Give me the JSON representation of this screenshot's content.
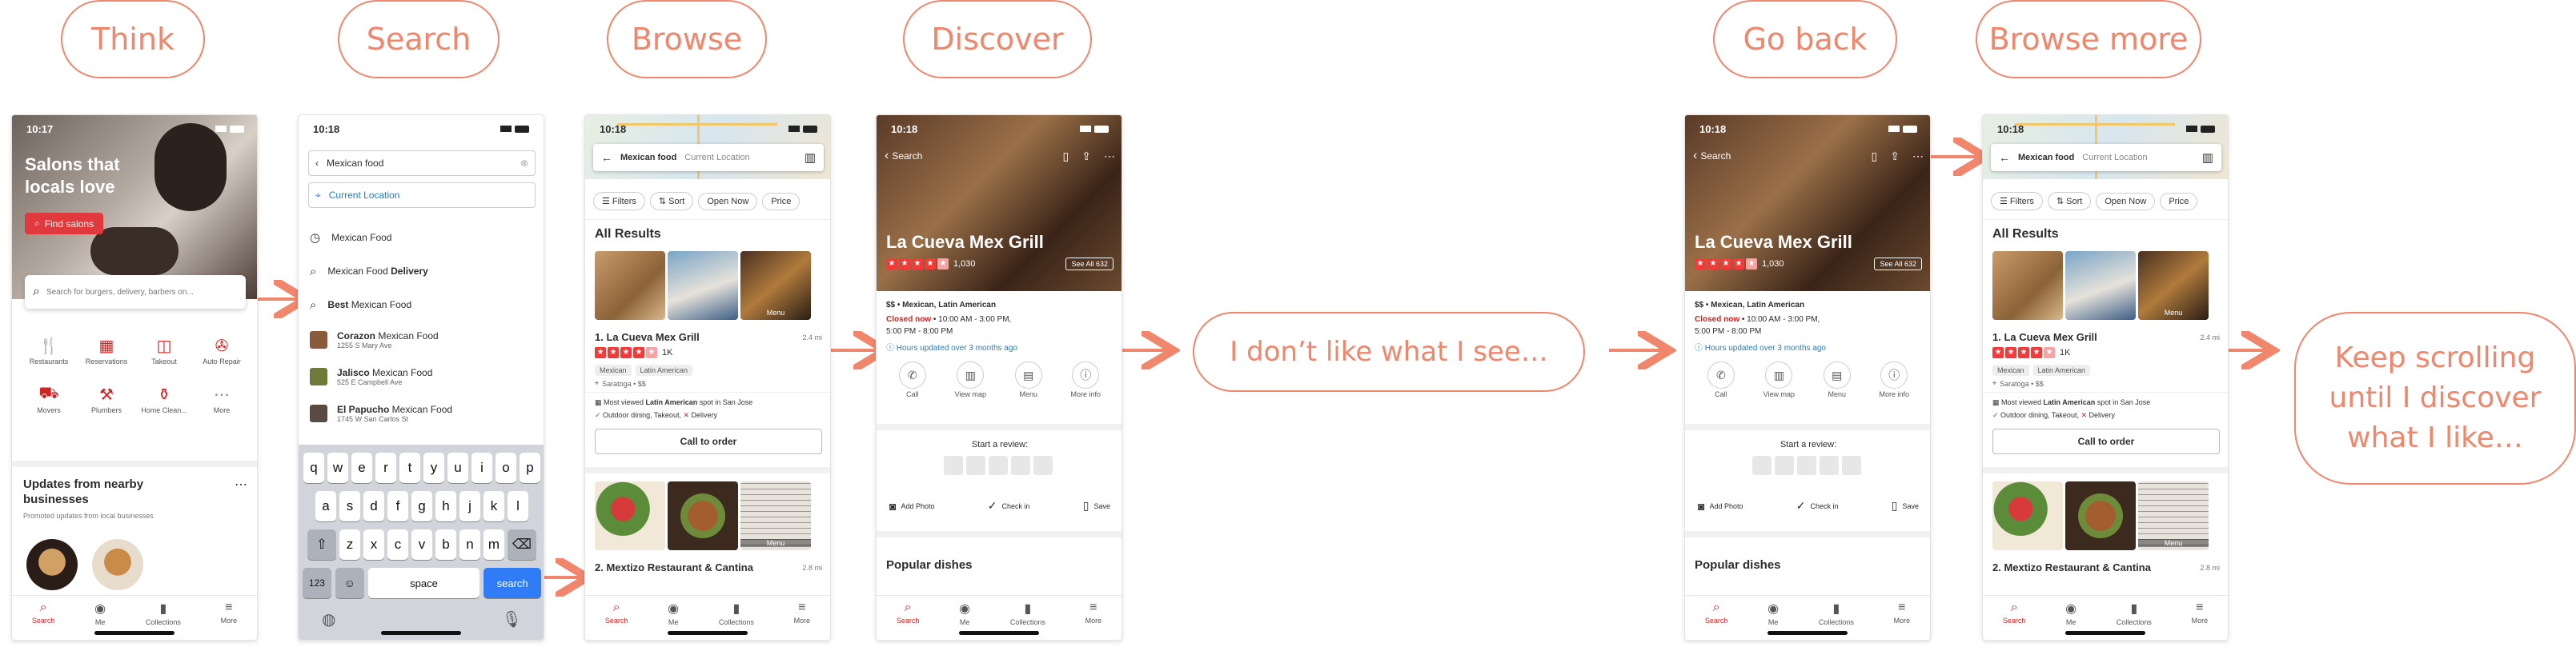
{
  "steps": [
    {
      "label": "Think"
    },
    {
      "label": "Search"
    },
    {
      "label": "Browse"
    },
    {
      "label": "Discover"
    },
    {
      "label": "Go back"
    },
    {
      "label": "Browse more"
    }
  ],
  "annotations": {
    "dislike": "I don’t like what I see…",
    "keep_scrolling": "Keep scrolling until I discover what I like…"
  },
  "colors": {
    "accent": "#f0866c",
    "yelp_red": "#d32323"
  },
  "status_time": "10:17",
  "status_time_b": "10:18",
  "home": {
    "hero_title": "Salons that locals love",
    "find_button": "Find salons",
    "search_placeholder": "Search for burgers, delivery, barbers on...",
    "categories": [
      "Restaurants",
      "Reservations",
      "Takeout",
      "Auto Repair",
      "Movers",
      "Plumbers",
      "Home Clean...",
      "More"
    ],
    "updates_title": "Updates from nearby businesses",
    "updates_sub": "Promoted updates from local businesses"
  },
  "tabs": [
    "Search",
    "Me",
    "Collections",
    "More"
  ],
  "search_screen": {
    "query": "Mexican food",
    "current_location": "Current Location",
    "suggestions": [
      {
        "text": "Mexican Food",
        "bold": ""
      },
      {
        "text": "Mexican Food ",
        "bold": "Delivery"
      },
      {
        "text": "",
        "bold": "Best",
        "rest": " Mexican Food"
      }
    ],
    "places": [
      {
        "name": "Corazon",
        "rest": " Mexican Food",
        "addr": "1255 S Mary Ave"
      },
      {
        "name": "Jalisco",
        "rest": " Mexican Food",
        "addr": "525 E Campbell Ave"
      },
      {
        "name": "El Papucho",
        "rest": " Mexican Food",
        "addr": "1745 W San Carlos St"
      }
    ],
    "keys_row1": [
      "q",
      "w",
      "e",
      "r",
      "t",
      "y",
      "u",
      "i",
      "o",
      "p"
    ],
    "keys_row2": [
      "a",
      "s",
      "d",
      "f",
      "g",
      "h",
      "j",
      "k",
      "l"
    ],
    "keys_row3": [
      "z",
      "x",
      "c",
      "v",
      "b",
      "n",
      "m"
    ],
    "key_123": "123",
    "key_space": "space",
    "key_search": "search"
  },
  "results": {
    "query": "Mexican food",
    "location": "Current Location",
    "filters": [
      "Filters",
      "Sort",
      "Open Now",
      "Price"
    ],
    "heading": "All Results",
    "r1_name": "1. La Cueva Mex Grill",
    "r1_dist": "2.4 mi",
    "r1_reviews": "1K",
    "r1_tags": [
      "Mexican",
      "Latin American"
    ],
    "r1_loc": "Saratoga • $$",
    "r1_note_pre": "Most viewed ",
    "r1_note_bold": "Latin American",
    "r1_note_post": " spot in San Jose",
    "r1_options": "Outdoor dining, Takeout,",
    "r1_delivery": "Delivery",
    "menu_label": "Menu",
    "call_button": "Call to order",
    "r2_name": "2. Mextizo Restaurant & Cantina",
    "r2_dist": "2.8 mi"
  },
  "biz": {
    "back": "Search",
    "name": "La Cueva Mex Grill",
    "reviews": "1,030",
    "see_all": "See All 632",
    "category": "$$ • Mexican, Latin American",
    "closed": "Closed now",
    "hours1": " • 10:00 AM - 3:00 PM,",
    "hours2": "5:00 PM - 8:00 PM",
    "updated": "Hours updated over 3 months ago",
    "actions": [
      "Call",
      "View map",
      "Menu",
      "More info"
    ],
    "review_prompt": "Start a review:",
    "row_actions": [
      "Add Photo",
      "Check in",
      "Save"
    ],
    "popular": "Popular dishes"
  }
}
